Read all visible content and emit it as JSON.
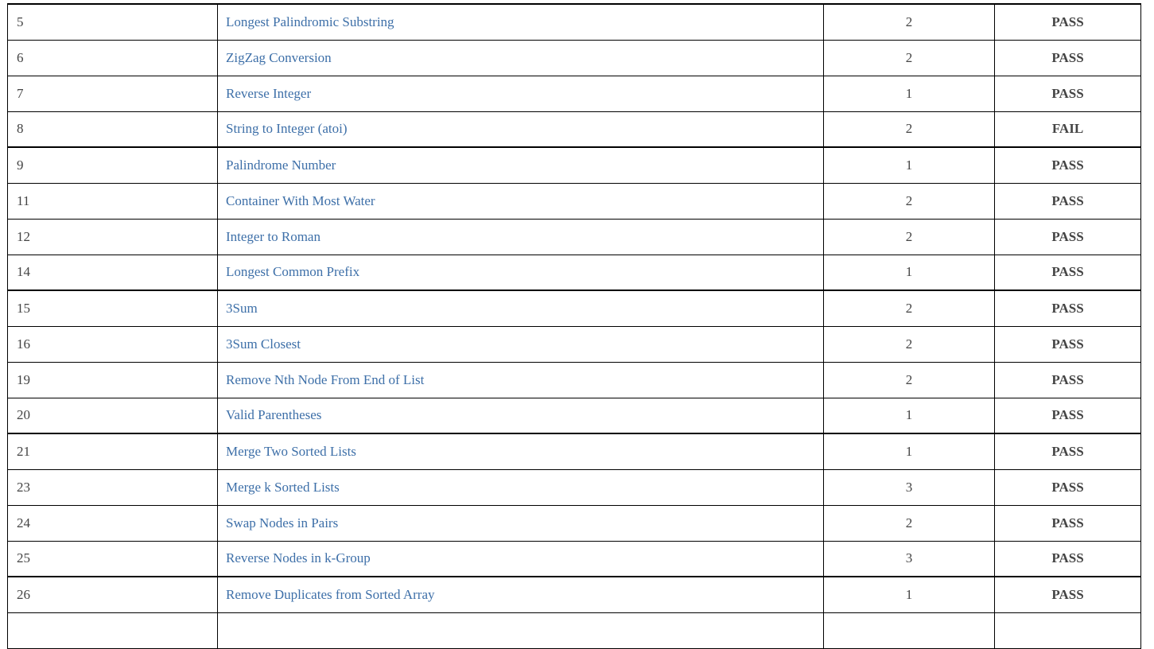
{
  "colors": {
    "link": "#3d6fa8",
    "pass": "#1a7a1a",
    "fail": "#e00000",
    "text": "#444444"
  },
  "rows": [
    {
      "id": "5",
      "title": "Longest Palindromic Substring",
      "difficulty": "2",
      "status": "PASS",
      "group_start": true
    },
    {
      "id": "6",
      "title": "ZigZag Conversion",
      "difficulty": "2",
      "status": "PASS",
      "group_start": false
    },
    {
      "id": "7",
      "title": "Reverse Integer",
      "difficulty": "1",
      "status": "PASS",
      "group_start": false
    },
    {
      "id": "8",
      "title": "String to Integer (atoi)",
      "difficulty": "2",
      "status": "FAIL",
      "group_start": false
    },
    {
      "id": "9",
      "title": "Palindrome Number",
      "difficulty": "1",
      "status": "PASS",
      "group_start": true
    },
    {
      "id": "11",
      "title": "Container With Most Water",
      "difficulty": "2",
      "status": "PASS",
      "group_start": false
    },
    {
      "id": "12",
      "title": "Integer to Roman",
      "difficulty": "2",
      "status": "PASS",
      "group_start": false
    },
    {
      "id": "14",
      "title": "Longest Common Prefix",
      "difficulty": "1",
      "status": "PASS",
      "group_start": false
    },
    {
      "id": "15",
      "title": "3Sum",
      "difficulty": "2",
      "status": "PASS",
      "group_start": true
    },
    {
      "id": "16",
      "title": "3Sum Closest",
      "difficulty": "2",
      "status": "PASS",
      "group_start": false
    },
    {
      "id": "19",
      "title": "Remove Nth Node From End of List",
      "difficulty": "2",
      "status": "PASS",
      "group_start": false
    },
    {
      "id": "20",
      "title": "Valid Parentheses",
      "difficulty": "1",
      "status": "PASS",
      "group_start": false
    },
    {
      "id": "21",
      "title": "Merge Two Sorted Lists",
      "difficulty": "1",
      "status": "PASS",
      "group_start": true
    },
    {
      "id": "23",
      "title": "Merge k Sorted Lists",
      "difficulty": "3",
      "status": "PASS",
      "group_start": false
    },
    {
      "id": "24",
      "title": "Swap Nodes in Pairs",
      "difficulty": "2",
      "status": "PASS",
      "group_start": false
    },
    {
      "id": "25",
      "title": "Reverse Nodes in k-Group",
      "difficulty": "3",
      "status": "PASS",
      "group_start": false
    },
    {
      "id": "26",
      "title": "Remove Duplicates from Sorted Array",
      "difficulty": "1",
      "status": "PASS",
      "group_start": true
    },
    {
      "id": "",
      "title": "",
      "difficulty": "",
      "status": "",
      "group_start": false
    }
  ]
}
